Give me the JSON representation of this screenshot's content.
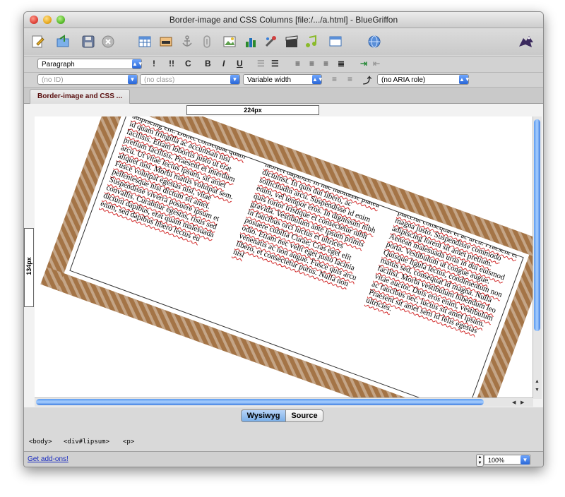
{
  "window": {
    "title": "Border-image and CSS Columns [file:/.../a.html] - BlueGriffon"
  },
  "toolbar2": {
    "paragraph_select": "Paragraph",
    "buttons": [
      "!",
      "!!",
      "C",
      "B",
      "I",
      "U"
    ]
  },
  "toolbar3": {
    "id_select": "(no ID)",
    "class_select": "(no class)",
    "width_select": "Variable width",
    "aria_select": "(no ARIA role)"
  },
  "tabs": [
    {
      "label": "Border-image and CSS ..."
    }
  ],
  "rulers": {
    "horizontal": "224px",
    "vertical": "134px"
  },
  "content": {
    "columns": [
      "Lorem ipsum dolor sit amet, consectetur adipiscing elit. Donec consequat quam id quam fringilla ac accumsan nisi facilisis. Etiam lobortis justo ut erat pretium facilisis. Praesent et interdum arcu. Ut vitae lectus ipsum, sit amet aliquet nisi. Morbi mattis volutpat sem. Fusce volutpat egestas nisl, vitae pellentesque nisi dictum sit amet. Suspendisse viverra posuere ipsum et convallis. Curabitur egestas, risus sed dictum dapibus, erat quam malesuada enim, sed dapibus libero lectus eu",
      "ligula. Cras nec lectus sit amet augue laoreet dapibus. In hac habitasse platea dictumst. In quis dui libero, ac sollicitudin arcu. Suspendisse id enim enim, vel tempor eros. In dignissim nibh quis tortor tristique et consectetur nibh gravida. Vestibulum ante ipsum primis in faucibus orci luctus et ultrices posuere cubilia Curae; Cras eget elit odio. Etiam nec velit eget justo lacinia venenatis ac non augue. Fusce quis arcu libero, et consectetur purus. Nulla non nisl",
      "enim. Vivamus non quam et nulla placerat consequat et ac arcu. Praesent et magna justo. Suspendisse commodo adipiscing lorem sit amet pretium. Aenean malesuada urna in dui euismod porta. Vestibulum ut congue augue. Quisque ligula lectus, condimentum non mattis sed, consequat id magna. Nulla facilisi. Morbi vestibulum bibendum leo vitae auctor. Duis eros enim, vestibulum ac faucibus nec, luctus sit amet ipsum. Praesent sit amet sem id felis egestas ultricies."
    ]
  },
  "modes": {
    "wysiwyg": "Wysiwyg",
    "source": "Source"
  },
  "breadcrumbs": [
    "<body>",
    "<div#lipsum>",
    "<p>"
  ],
  "status": {
    "addons_link": "Get add-ons!",
    "zoom": "100%"
  },
  "colors": {
    "border_ornament": "#a47446",
    "spell_underline": "#d02020",
    "scroll_thumb": "#5b9bf0"
  }
}
